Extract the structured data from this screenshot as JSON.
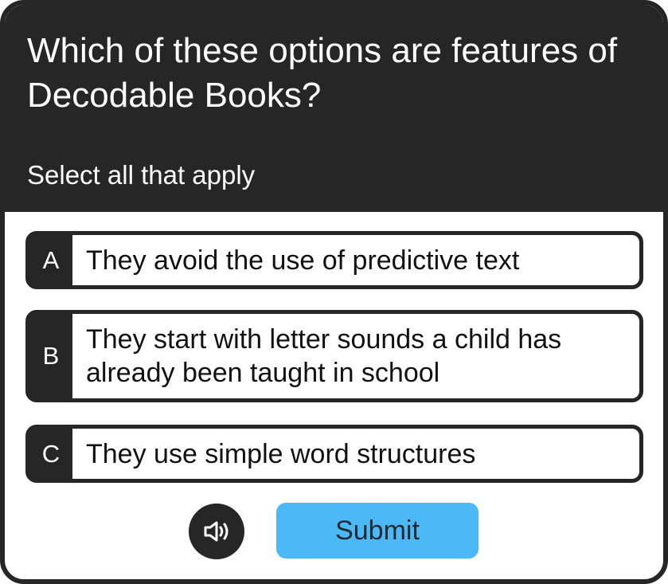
{
  "question": {
    "title": "Which of these options are features of Decodable Books?",
    "instruction": "Select all that apply"
  },
  "options": [
    {
      "letter": "A",
      "text": "They avoid the use of predictive text"
    },
    {
      "letter": "B",
      "text": "They start with letter sounds a child has already been taught in school"
    },
    {
      "letter": "C",
      "text": "They use simple word structures"
    }
  ],
  "controls": {
    "audio_icon": "speaker-icon",
    "submit_label": "Submit"
  },
  "colors": {
    "header_bg": "#262626",
    "submit_bg": "#4cb8f5",
    "text_dark": "#111111",
    "text_light": "#ffffff"
  }
}
